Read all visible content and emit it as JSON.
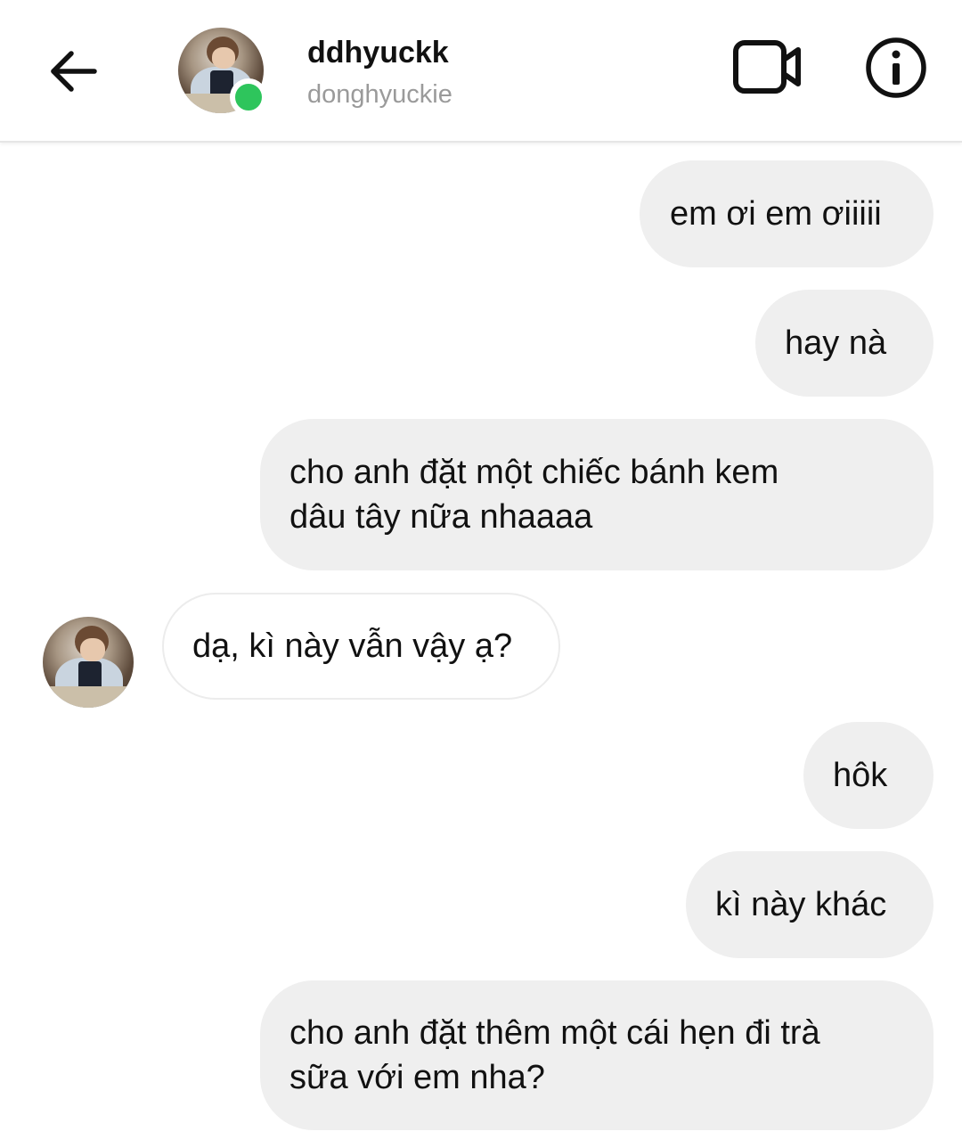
{
  "header": {
    "username": "ddhyuckk",
    "handle": "donghyuckie",
    "online_color": "#2ec55c",
    "icons": {
      "back": "arrow-left-icon",
      "video": "video-camera-icon",
      "info": "info-icon"
    }
  },
  "messages": [
    {
      "sender": "me",
      "text": "em ơi em ơiiiii"
    },
    {
      "sender": "me",
      "text": "hay nà"
    },
    {
      "sender": "me",
      "lines": [
        "cho anh đặt một chiếc bánh kem",
        "dâu tây nữa nhaaaa"
      ]
    },
    {
      "sender": "other",
      "text": "dạ, kì này vẫn vậy ạ?"
    },
    {
      "sender": "me",
      "text": "hôk"
    },
    {
      "sender": "me",
      "text": "kì này khác"
    },
    {
      "sender": "me",
      "lines": [
        "cho anh đặt thêm một cái hẹn đi trà",
        "sữa với em nha?"
      ]
    }
  ],
  "colors": {
    "outgoing_bubble": "#efefef",
    "incoming_bubble": "#ffffff",
    "handle_text": "#9a9a9a"
  }
}
